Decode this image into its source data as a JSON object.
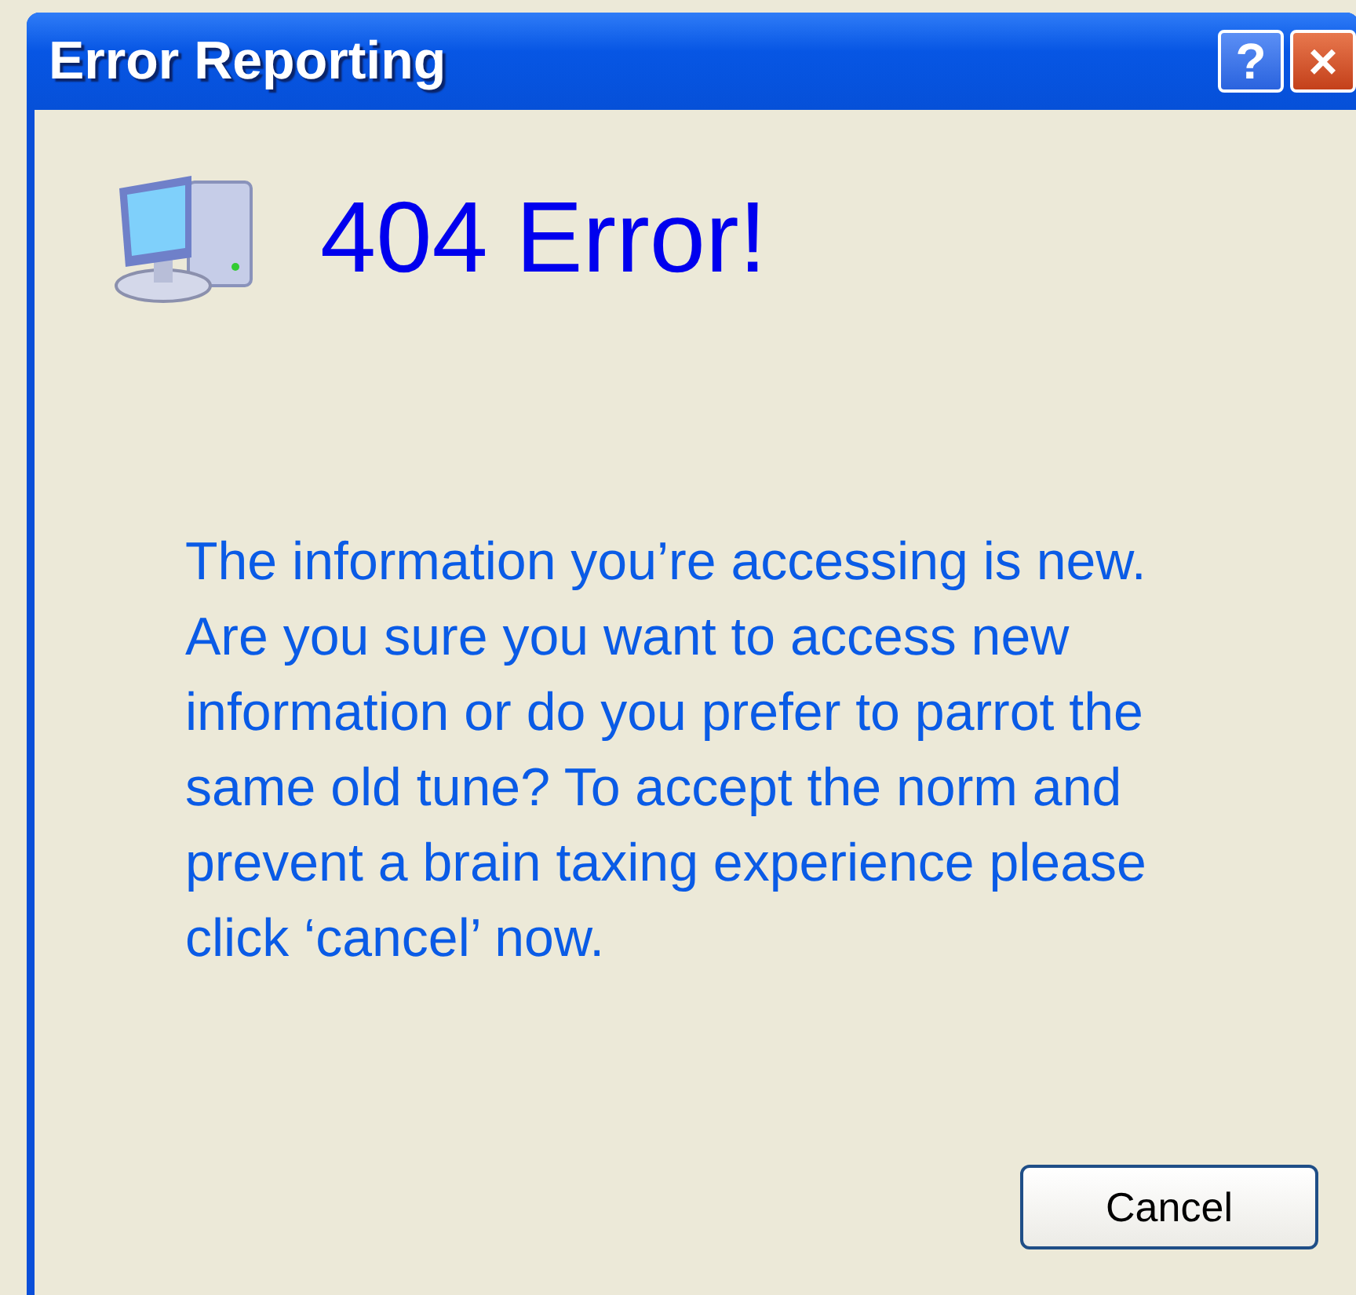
{
  "window": {
    "title": "Error Reporting",
    "help_button": "?",
    "close_button": "×"
  },
  "heading": "404 Error!",
  "message": "The information you’re accessing is new. Are you sure you want to access new information or do you prefer to parrot the same old tune? To accept the norm and prevent a brain taxing experience please click ‘cancel’ now.",
  "buttons": [
    "Cancel"
  ]
}
